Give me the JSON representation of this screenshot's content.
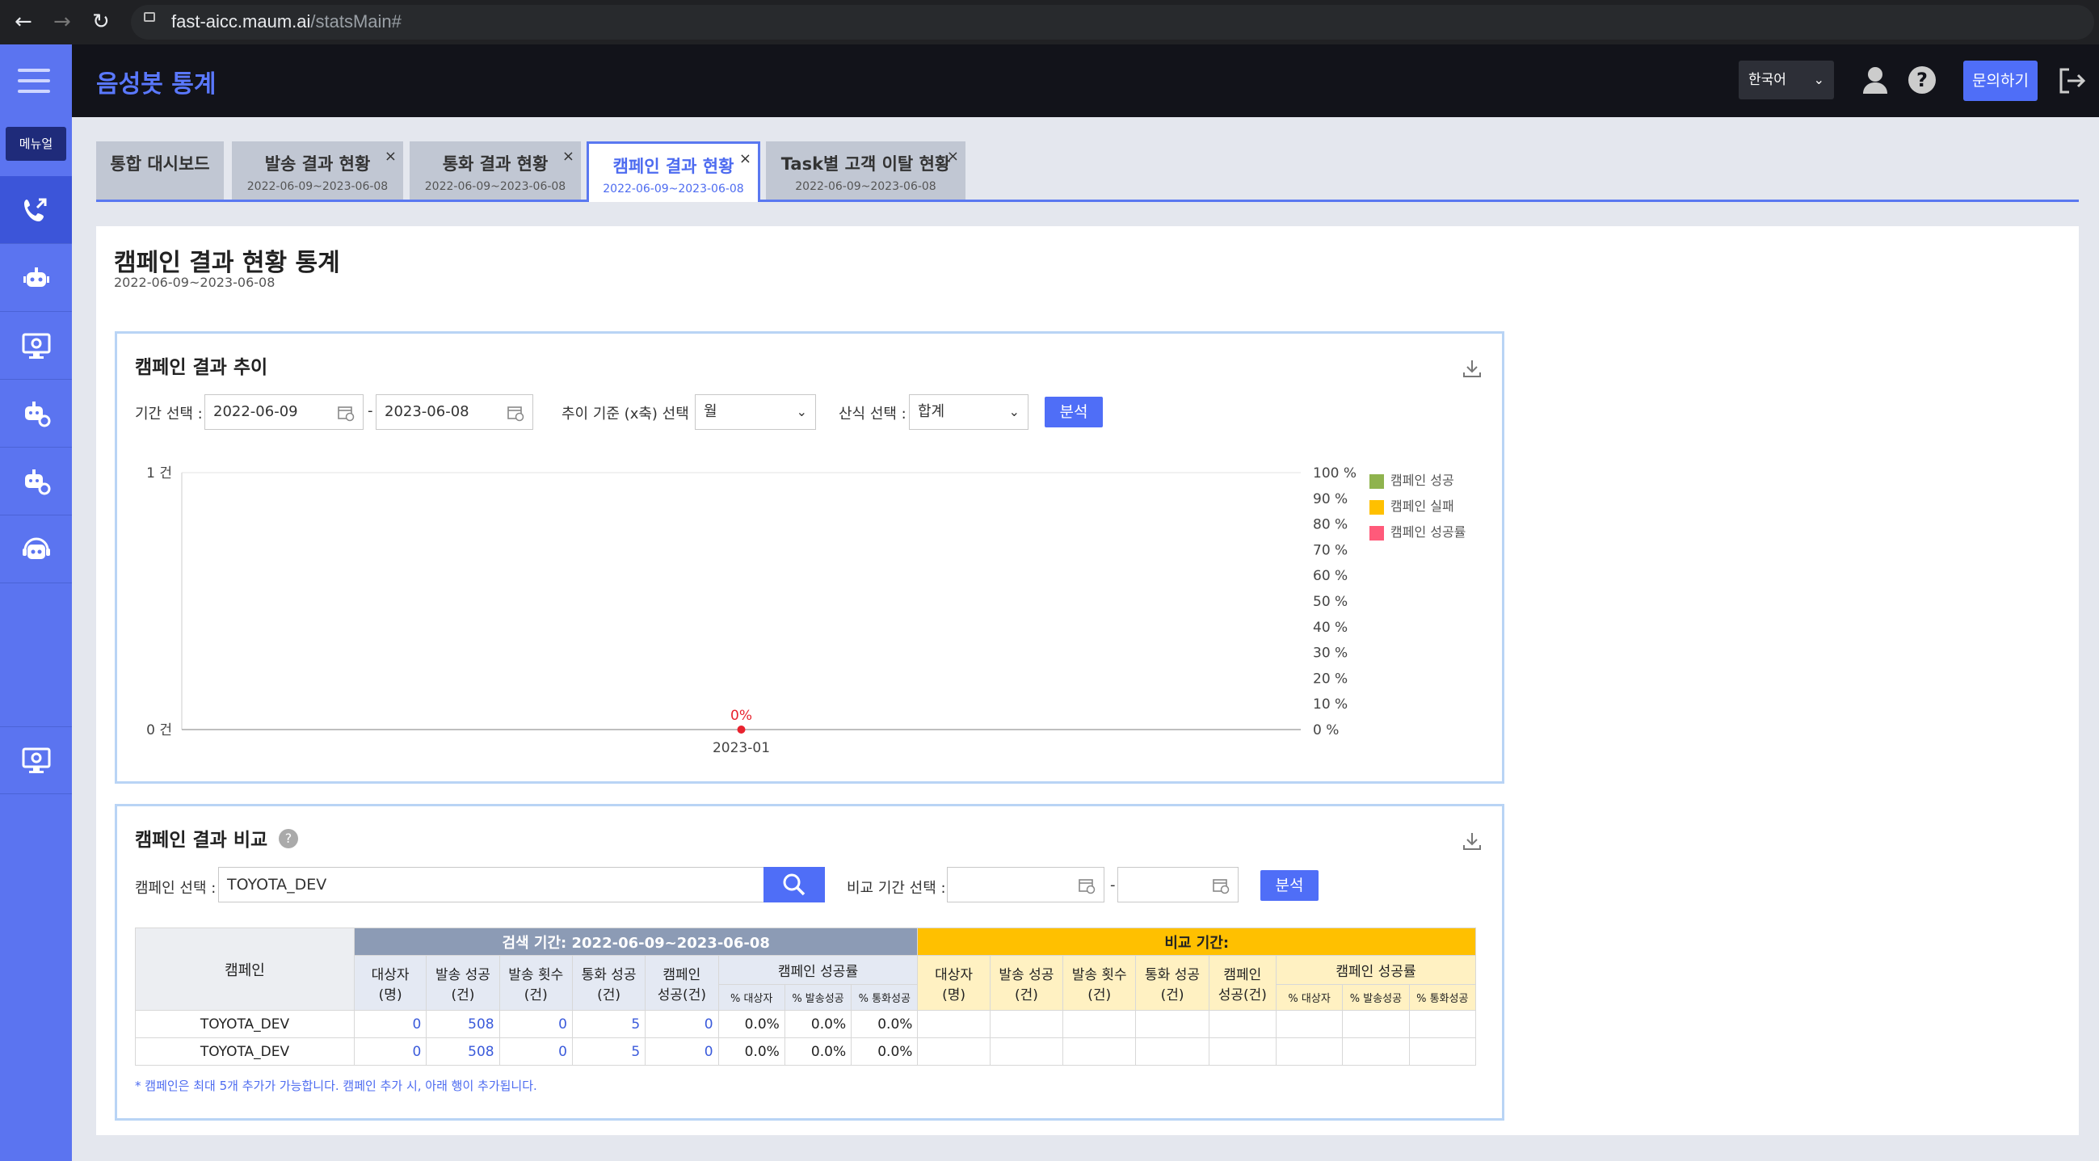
{
  "browser": {
    "url_host": "fast-aicc.maum.ai",
    "url_path": "/statsMain#"
  },
  "sidebar": {
    "menu_tag": "메뉴얼"
  },
  "header": {
    "title": "음성봇 통계",
    "language": "한국어",
    "inquiry": "문의하기"
  },
  "tabs": [
    {
      "label": "통합 대시보드",
      "date": "",
      "closable": false,
      "active": false
    },
    {
      "label": "발송 결과 현황",
      "date": "2022-06-09~2023-06-08",
      "closable": true,
      "active": false
    },
    {
      "label": "통화 결과 현황",
      "date": "2022-06-09~2023-06-08",
      "closable": true,
      "active": false
    },
    {
      "label": "캠페인 결과 현황",
      "date": "2022-06-09~2023-06-08",
      "closable": true,
      "active": true
    },
    {
      "label": "Task별 고객 이탈 현황",
      "date": "2022-06-09~2023-06-08",
      "closable": true,
      "active": false
    }
  ],
  "page": {
    "title": "캠페인 결과 현황 통계",
    "date": "2022-06-09~2023-06-08"
  },
  "trend": {
    "title": "캠페인 결과 추이",
    "period_label": "기간 선택 :",
    "start_date": "2022-06-09",
    "end_date": "2023-06-08",
    "axis_label": "추이 기준 (x축) 선택 :",
    "axis_value": "월",
    "formula_label": "산식 선택 :",
    "formula_value": "합계",
    "analyze": "분석"
  },
  "chart_data": {
    "type": "line",
    "x": [
      "2023-01"
    ],
    "y_left_ticks": [
      "1 건",
      "0 건"
    ],
    "y_right_ticks": [
      "100 %",
      "90 %",
      "80 %",
      "70 %",
      "60 %",
      "50 %",
      "40 %",
      "30 %",
      "20 %",
      "10 %",
      "0 %"
    ],
    "ylim_left": [
      0,
      1
    ],
    "ylim_right": [
      0,
      100
    ],
    "legend_position": "right",
    "series": [
      {
        "name": "캠페인 성공",
        "color": "#8fb34e",
        "values": [
          0
        ]
      },
      {
        "name": "캠페인 실패",
        "color": "#ffc000",
        "values": [
          0
        ]
      },
      {
        "name": "캠페인 성공률",
        "color": "#ff5a7a",
        "values": [
          0
        ]
      }
    ],
    "point_label": "0%"
  },
  "compare": {
    "title": "캠페인 결과 비교",
    "help": "?",
    "campaign_label": "캠페인 선택 :",
    "campaign_value": "TOYOTA_DEV",
    "period_label": "비교 기간 선택 :",
    "start_date": "",
    "end_date": "",
    "analyze": "분석",
    "table": {
      "campaign_header": "캠페인",
      "search_period": "검색 기간: 2022-06-09~2023-06-08",
      "compare_period": "비교 기간:",
      "cols": [
        "대상자\n(명)",
        "발송 성공\n(건)",
        "발송 횟수\n(건)",
        "통화 성공\n(건)",
        "캠페인\n성공(건)"
      ],
      "rate_header": "캠페인 성공률",
      "rate_cols": [
        "% 대상자",
        "% 발송성공",
        "% 통화성공"
      ],
      "rows": [
        {
          "name": "TOYOTA_DEV",
          "vals": [
            "0",
            "508",
            "0",
            "5",
            "0"
          ],
          "rates": [
            "0.0%",
            "0.0%",
            "0.0%"
          ]
        },
        {
          "name": "TOYOTA_DEV",
          "vals": [
            "0",
            "508",
            "0",
            "5",
            "0"
          ],
          "rates": [
            "0.0%",
            "0.0%",
            "0.0%"
          ]
        }
      ]
    },
    "note": "* 캠페인은 최대 5개 추가가 가능합니다. 캠페인 추가 시, 아래 행이 추가됩니다."
  }
}
